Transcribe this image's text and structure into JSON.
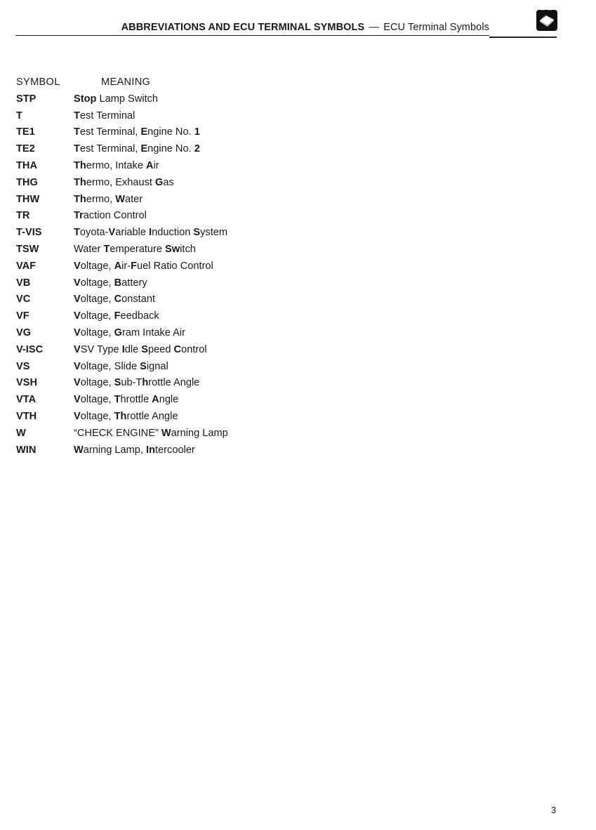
{
  "header": {
    "title_bold": "ABBREVIATIONS AND ECU TERMINAL SYMBOLS",
    "separator": "—",
    "subtitle": "ECU Terminal Symbols",
    "icon": "open-book-icon"
  },
  "table": {
    "columns": {
      "symbol": "SYMBOL",
      "meaning": "MEANING"
    },
    "rows": [
      {
        "symbol": "STP",
        "meaning": [
          [
            "Stop",
            true
          ],
          [
            " Lamp Switch",
            false
          ]
        ]
      },
      {
        "symbol": "T",
        "meaning": [
          [
            "T",
            true
          ],
          [
            "est Terminal",
            false
          ]
        ]
      },
      {
        "symbol": "TE1",
        "meaning": [
          [
            "T",
            true
          ],
          [
            "est Terminal, ",
            false
          ],
          [
            "E",
            true
          ],
          [
            "ngine No. ",
            false
          ],
          [
            "1",
            true
          ]
        ]
      },
      {
        "symbol": "TE2",
        "meaning": [
          [
            "T",
            true
          ],
          [
            "est Terminal, ",
            false
          ],
          [
            "E",
            true
          ],
          [
            "ngine No. ",
            false
          ],
          [
            "2",
            true
          ]
        ]
      },
      {
        "symbol": "THA",
        "meaning": [
          [
            "Th",
            true
          ],
          [
            "ermo, Intake ",
            false
          ],
          [
            "A",
            true
          ],
          [
            "ir",
            false
          ]
        ]
      },
      {
        "symbol": "THG",
        "meaning": [
          [
            "Th",
            true
          ],
          [
            "ermo, Exhaust ",
            false
          ],
          [
            "G",
            true
          ],
          [
            "as",
            false
          ]
        ]
      },
      {
        "symbol": "THW",
        "meaning": [
          [
            "Th",
            true
          ],
          [
            "ermo, ",
            false
          ],
          [
            "W",
            true
          ],
          [
            "ater",
            false
          ]
        ]
      },
      {
        "symbol": "TR",
        "meaning": [
          [
            "Tr",
            true
          ],
          [
            "action Control",
            false
          ]
        ]
      },
      {
        "symbol": "T-VIS",
        "meaning": [
          [
            "T",
            true
          ],
          [
            "oyota-",
            false
          ],
          [
            "V",
            true
          ],
          [
            "ariable ",
            false
          ],
          [
            "I",
            true
          ],
          [
            "nduction ",
            false
          ],
          [
            "S",
            true
          ],
          [
            "ystem",
            false
          ]
        ]
      },
      {
        "symbol": "TSW",
        "meaning": [
          [
            "Water ",
            false
          ],
          [
            "T",
            true
          ],
          [
            "emperature ",
            false
          ],
          [
            "Sw",
            true
          ],
          [
            "itch",
            false
          ]
        ]
      },
      {
        "symbol": "VAF",
        "meaning": [
          [
            "V",
            true
          ],
          [
            "oltage, ",
            false
          ],
          [
            "A",
            true
          ],
          [
            "ir-",
            false
          ],
          [
            "F",
            true
          ],
          [
            "uel Ratio Control",
            false
          ]
        ]
      },
      {
        "symbol": "VB",
        "meaning": [
          [
            "V",
            true
          ],
          [
            "oltage, ",
            false
          ],
          [
            "B",
            true
          ],
          [
            "attery",
            false
          ]
        ]
      },
      {
        "symbol": "VC",
        "meaning": [
          [
            "V",
            true
          ],
          [
            "oltage, ",
            false
          ],
          [
            "C",
            true
          ],
          [
            "onstant",
            false
          ]
        ]
      },
      {
        "symbol": "VF",
        "meaning": [
          [
            "V",
            true
          ],
          [
            "oltage, ",
            false
          ],
          [
            "F",
            true
          ],
          [
            "eedback",
            false
          ]
        ]
      },
      {
        "symbol": "VG",
        "meaning": [
          [
            "V",
            true
          ],
          [
            "oltage, ",
            false
          ],
          [
            "G",
            true
          ],
          [
            "ram Intake Air",
            false
          ]
        ]
      },
      {
        "symbol": "V-ISC",
        "meaning": [
          [
            "V",
            true
          ],
          [
            "SV Type ",
            false
          ],
          [
            "I",
            true
          ],
          [
            "dle ",
            false
          ],
          [
            "S",
            true
          ],
          [
            "peed ",
            false
          ],
          [
            "C",
            true
          ],
          [
            "ontrol",
            false
          ]
        ]
      },
      {
        "symbol": "VS",
        "meaning": [
          [
            "V",
            true
          ],
          [
            "oltage, Slide ",
            false
          ],
          [
            "S",
            true
          ],
          [
            "ignal",
            false
          ]
        ]
      },
      {
        "symbol": "VSH",
        "meaning": [
          [
            "V",
            true
          ],
          [
            "oltage, ",
            false
          ],
          [
            "S",
            true
          ],
          [
            "ub-T",
            false
          ],
          [
            "h",
            true
          ],
          [
            "rottle Angle",
            false
          ]
        ]
      },
      {
        "symbol": "VTA",
        "meaning": [
          [
            "V",
            true
          ],
          [
            "oltage, ",
            false
          ],
          [
            "T",
            true
          ],
          [
            "hrottle ",
            false
          ],
          [
            "A",
            true
          ],
          [
            "ngle",
            false
          ]
        ]
      },
      {
        "symbol": "VTH",
        "meaning": [
          [
            "V",
            true
          ],
          [
            "oltage, ",
            false
          ],
          [
            "Th",
            true
          ],
          [
            "rottle Angle",
            false
          ]
        ]
      },
      {
        "symbol": "W",
        "meaning": [
          [
            "“CHECK ENGINE” ",
            false
          ],
          [
            "W",
            true
          ],
          [
            "arning Lamp",
            false
          ]
        ]
      },
      {
        "symbol": "WIN",
        "meaning": [
          [
            "W",
            true
          ],
          [
            "arning Lamp, ",
            false
          ],
          [
            "In",
            true
          ],
          [
            "tercooler",
            false
          ]
        ]
      }
    ]
  },
  "footer": {
    "page_number": "3"
  }
}
